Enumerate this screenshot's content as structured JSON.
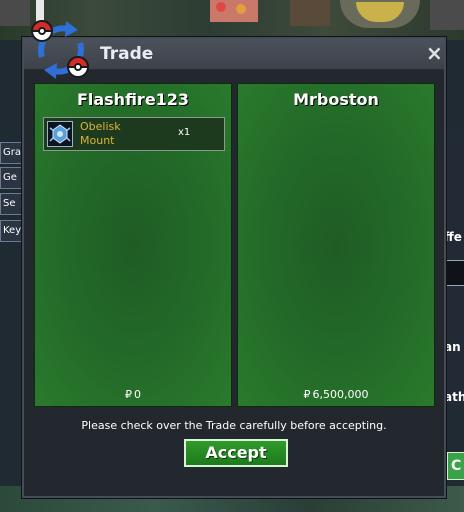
{
  "window": {
    "title": "Trade",
    "close_symbol": "×"
  },
  "traders": [
    {
      "name": "Flashfire123",
      "items": [
        {
          "name": "Obelisk Mount",
          "quantity": "x1",
          "icon": "obelisk-mount-icon"
        }
      ],
      "money": "0"
    },
    {
      "name": "Mrboston",
      "items": [],
      "money": "6,500,000"
    }
  ],
  "currency_symbol": "₽",
  "notice": "Please check over the Trade carefully before accepting.",
  "accept_label": "Accept",
  "background": {
    "side_buttons": [
      "Gra",
      "Ge",
      "Se",
      "Key"
    ],
    "right_fragments": [
      "ffe",
      "an",
      "ath"
    ],
    "right_button": "C"
  },
  "colors": {
    "panel_green": "#236b28",
    "item_gold": "#d8b536",
    "accept_green": "#2f9b2a",
    "window_bg": "#23282f"
  }
}
